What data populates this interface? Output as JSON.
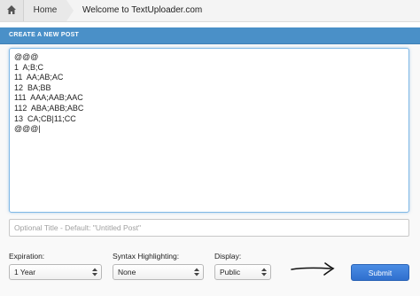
{
  "breadcrumb": {
    "home_label": "Home",
    "current": "Welcome to TextUploader.com"
  },
  "panel": {
    "title": "CREATE A NEW POST"
  },
  "editor": {
    "content": "@@@\n1  A;B;C\n11  AA;AB;AC\n12  BA;BB\n111  AAA;AAB;AAC\n112  ABA;ABB;ABC\n13  CA;CB|11;CC\n@@@|"
  },
  "title_input": {
    "value": "",
    "placeholder": "Optional Title - Default: \"Untitled Post\""
  },
  "options": {
    "expiration": {
      "label": "Expiration:",
      "value": "1 Year"
    },
    "syntax": {
      "label": "Syntax Highlighting:",
      "value": "None"
    },
    "display": {
      "label": "Display:",
      "value": "Public"
    }
  },
  "submit_label": "Submit",
  "colors": {
    "header": "#4a90c8",
    "button": "#2f6fce"
  }
}
